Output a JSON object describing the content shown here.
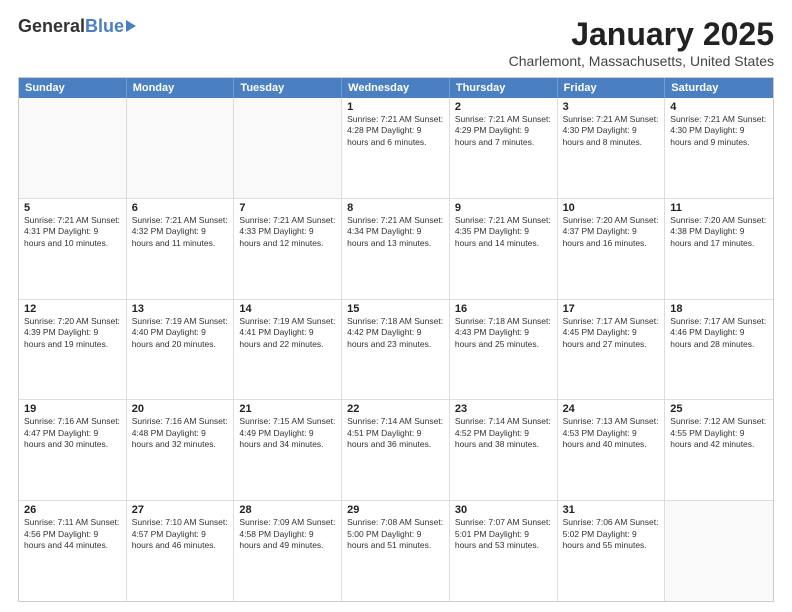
{
  "logo": {
    "general": "General",
    "blue": "Blue"
  },
  "title": "January 2025",
  "subtitle": "Charlemont, Massachusetts, United States",
  "header_days": [
    "Sunday",
    "Monday",
    "Tuesday",
    "Wednesday",
    "Thursday",
    "Friday",
    "Saturday"
  ],
  "weeks": [
    [
      {
        "day": "",
        "info": ""
      },
      {
        "day": "",
        "info": ""
      },
      {
        "day": "",
        "info": ""
      },
      {
        "day": "1",
        "info": "Sunrise: 7:21 AM\nSunset: 4:28 PM\nDaylight: 9 hours\nand 6 minutes."
      },
      {
        "day": "2",
        "info": "Sunrise: 7:21 AM\nSunset: 4:29 PM\nDaylight: 9 hours\nand 7 minutes."
      },
      {
        "day": "3",
        "info": "Sunrise: 7:21 AM\nSunset: 4:30 PM\nDaylight: 9 hours\nand 8 minutes."
      },
      {
        "day": "4",
        "info": "Sunrise: 7:21 AM\nSunset: 4:30 PM\nDaylight: 9 hours\nand 9 minutes."
      }
    ],
    [
      {
        "day": "5",
        "info": "Sunrise: 7:21 AM\nSunset: 4:31 PM\nDaylight: 9 hours\nand 10 minutes."
      },
      {
        "day": "6",
        "info": "Sunrise: 7:21 AM\nSunset: 4:32 PM\nDaylight: 9 hours\nand 11 minutes."
      },
      {
        "day": "7",
        "info": "Sunrise: 7:21 AM\nSunset: 4:33 PM\nDaylight: 9 hours\nand 12 minutes."
      },
      {
        "day": "8",
        "info": "Sunrise: 7:21 AM\nSunset: 4:34 PM\nDaylight: 9 hours\nand 13 minutes."
      },
      {
        "day": "9",
        "info": "Sunrise: 7:21 AM\nSunset: 4:35 PM\nDaylight: 9 hours\nand 14 minutes."
      },
      {
        "day": "10",
        "info": "Sunrise: 7:20 AM\nSunset: 4:37 PM\nDaylight: 9 hours\nand 16 minutes."
      },
      {
        "day": "11",
        "info": "Sunrise: 7:20 AM\nSunset: 4:38 PM\nDaylight: 9 hours\nand 17 minutes."
      }
    ],
    [
      {
        "day": "12",
        "info": "Sunrise: 7:20 AM\nSunset: 4:39 PM\nDaylight: 9 hours\nand 19 minutes."
      },
      {
        "day": "13",
        "info": "Sunrise: 7:19 AM\nSunset: 4:40 PM\nDaylight: 9 hours\nand 20 minutes."
      },
      {
        "day": "14",
        "info": "Sunrise: 7:19 AM\nSunset: 4:41 PM\nDaylight: 9 hours\nand 22 minutes."
      },
      {
        "day": "15",
        "info": "Sunrise: 7:18 AM\nSunset: 4:42 PM\nDaylight: 9 hours\nand 23 minutes."
      },
      {
        "day": "16",
        "info": "Sunrise: 7:18 AM\nSunset: 4:43 PM\nDaylight: 9 hours\nand 25 minutes."
      },
      {
        "day": "17",
        "info": "Sunrise: 7:17 AM\nSunset: 4:45 PM\nDaylight: 9 hours\nand 27 minutes."
      },
      {
        "day": "18",
        "info": "Sunrise: 7:17 AM\nSunset: 4:46 PM\nDaylight: 9 hours\nand 28 minutes."
      }
    ],
    [
      {
        "day": "19",
        "info": "Sunrise: 7:16 AM\nSunset: 4:47 PM\nDaylight: 9 hours\nand 30 minutes."
      },
      {
        "day": "20",
        "info": "Sunrise: 7:16 AM\nSunset: 4:48 PM\nDaylight: 9 hours\nand 32 minutes."
      },
      {
        "day": "21",
        "info": "Sunrise: 7:15 AM\nSunset: 4:49 PM\nDaylight: 9 hours\nand 34 minutes."
      },
      {
        "day": "22",
        "info": "Sunrise: 7:14 AM\nSunset: 4:51 PM\nDaylight: 9 hours\nand 36 minutes."
      },
      {
        "day": "23",
        "info": "Sunrise: 7:14 AM\nSunset: 4:52 PM\nDaylight: 9 hours\nand 38 minutes."
      },
      {
        "day": "24",
        "info": "Sunrise: 7:13 AM\nSunset: 4:53 PM\nDaylight: 9 hours\nand 40 minutes."
      },
      {
        "day": "25",
        "info": "Sunrise: 7:12 AM\nSunset: 4:55 PM\nDaylight: 9 hours\nand 42 minutes."
      }
    ],
    [
      {
        "day": "26",
        "info": "Sunrise: 7:11 AM\nSunset: 4:56 PM\nDaylight: 9 hours\nand 44 minutes."
      },
      {
        "day": "27",
        "info": "Sunrise: 7:10 AM\nSunset: 4:57 PM\nDaylight: 9 hours\nand 46 minutes."
      },
      {
        "day": "28",
        "info": "Sunrise: 7:09 AM\nSunset: 4:58 PM\nDaylight: 9 hours\nand 49 minutes."
      },
      {
        "day": "29",
        "info": "Sunrise: 7:08 AM\nSunset: 5:00 PM\nDaylight: 9 hours\nand 51 minutes."
      },
      {
        "day": "30",
        "info": "Sunrise: 7:07 AM\nSunset: 5:01 PM\nDaylight: 9 hours\nand 53 minutes."
      },
      {
        "day": "31",
        "info": "Sunrise: 7:06 AM\nSunset: 5:02 PM\nDaylight: 9 hours\nand 55 minutes."
      },
      {
        "day": "",
        "info": ""
      }
    ]
  ]
}
